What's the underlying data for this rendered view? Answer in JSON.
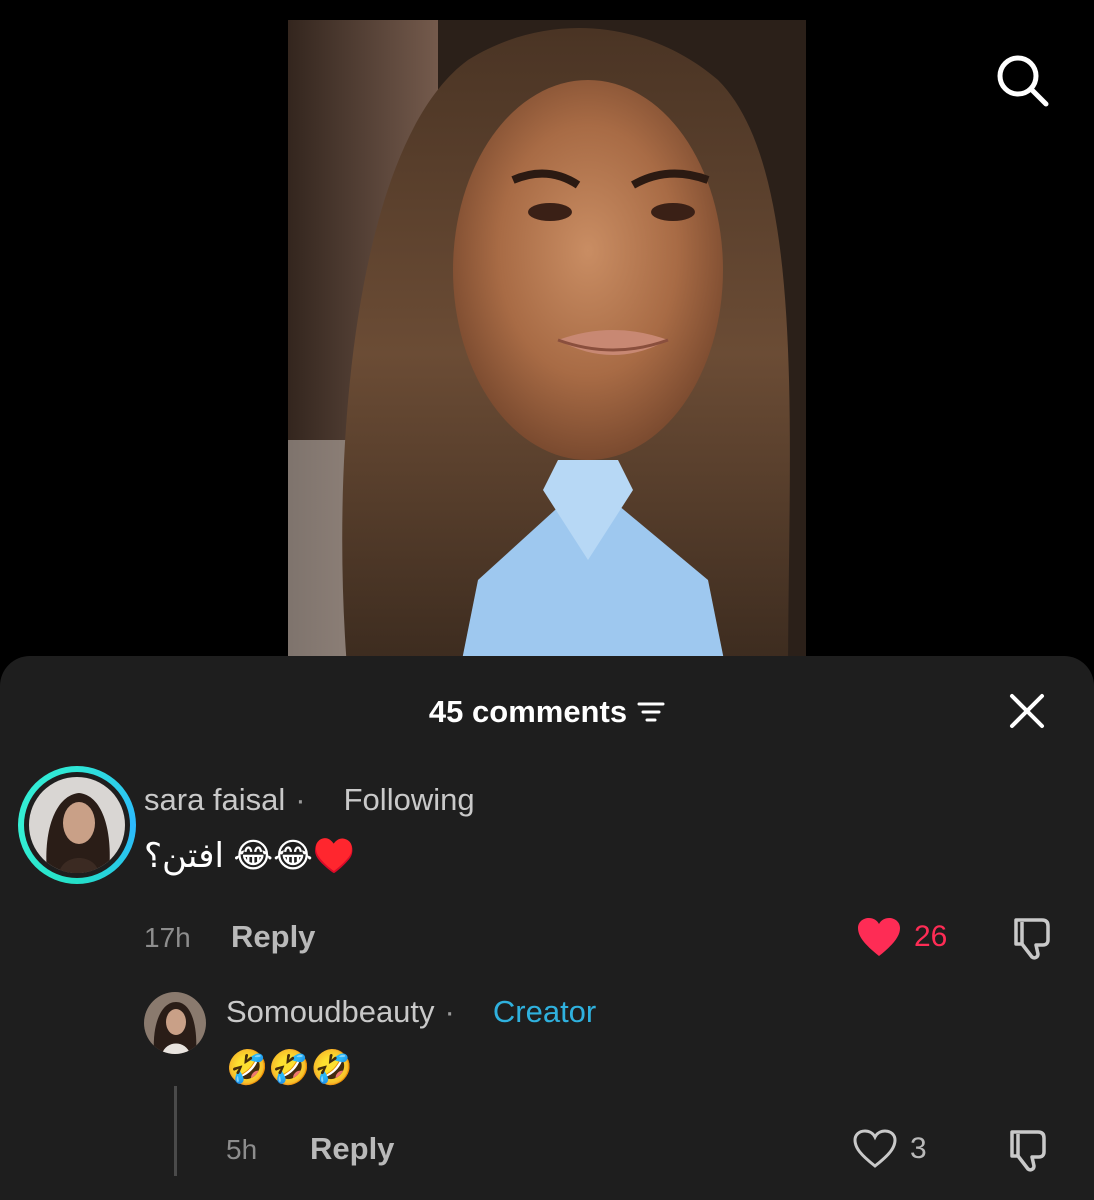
{
  "header": {
    "comments_count_label": "45 comments"
  },
  "icons": {
    "search": "search-icon",
    "close": "close-icon",
    "sort": "sort-icon",
    "heart_filled": "heart-filled-icon",
    "heart_outline": "heart-outline-icon",
    "dislike": "dislike-icon"
  },
  "colors": {
    "like_active": "#fe2c55",
    "creator_badge": "#2fb1de",
    "sheet_bg": "#1e1e1e"
  },
  "comments": [
    {
      "username": "sara faisal",
      "separator": "·",
      "relation": "Following",
      "text": "افتن؟ 😂😂♥️",
      "time": "17h",
      "reply_label": "Reply",
      "likes": "26",
      "liked": true
    }
  ],
  "reply": {
    "username": "Somoudbeauty",
    "separator": "·",
    "badge": "Creator",
    "text": "🤣🤣🤣",
    "time": "5h",
    "reply_label": "Reply",
    "likes": "3",
    "liked": false
  }
}
